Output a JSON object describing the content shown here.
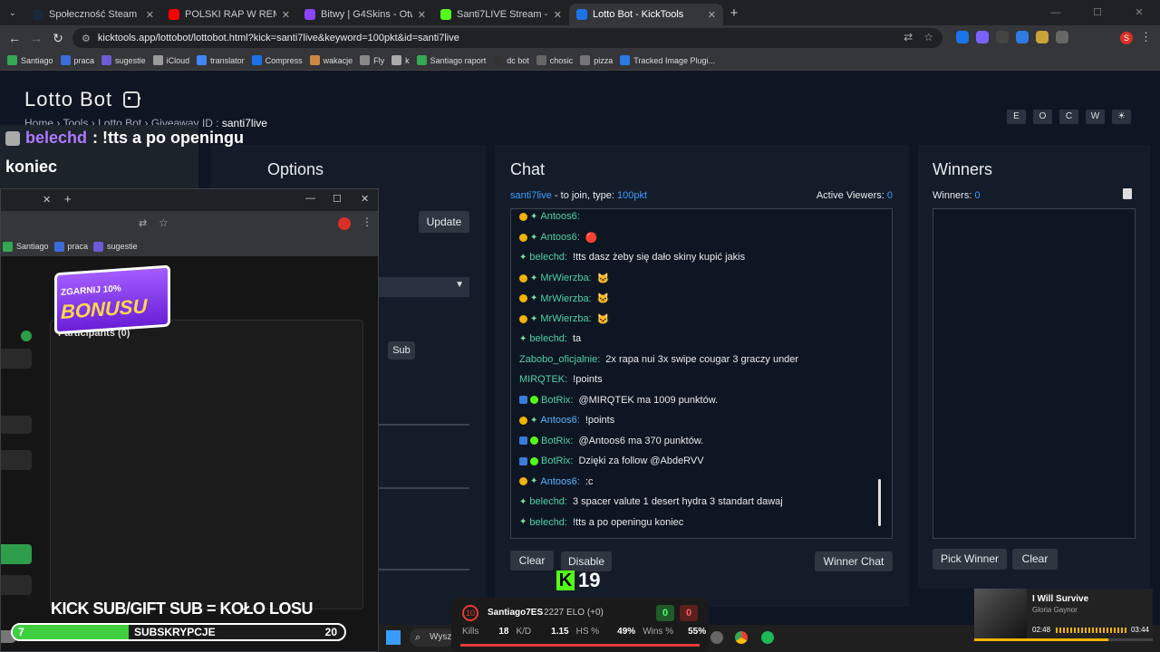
{
  "browser": {
    "tabs": [
      {
        "title": "Społeczność Steam :: Santiago",
        "color": "#1b2838",
        "active": false
      },
      {
        "title": "POLSKI RAP W REMIX",
        "color": "#ff0000",
        "active": false
      },
      {
        "title": "Bitwy | G4Skins - Otwieraj skrzy",
        "color": "#8e44ff",
        "active": false
      },
      {
        "title": "Santi7LIVE Stream - Watch Live",
        "color": "#53fc18",
        "active": false
      },
      {
        "title": "Lotto Bot - KickTools",
        "color": "#1a73e8",
        "active": true
      }
    ],
    "url": "kicktools.app/lottobot/lottobot.html?kick=santi7live&keyword=100pkt&id=santi7live",
    "bookmarks": [
      "Santiago",
      "praca",
      "sugestie",
      "iCloud",
      "translator",
      "Compress",
      "wakacje",
      "Fly",
      "k",
      "Santiago raport",
      "dc bot",
      "chosic",
      "pizza",
      "Tracked Image Plugi..."
    ]
  },
  "page": {
    "title": "Lotto Bot",
    "breadcrumb_prefix": "Home › Tools › Lotto Bot › Giveaway ID :",
    "giveaway_id": "santi7live",
    "top_buttons": [
      "E",
      "O",
      "C",
      "W",
      "☀"
    ]
  },
  "options": {
    "title": "Options",
    "update_label": "Update",
    "sub_label": "Sub"
  },
  "chat": {
    "title": "Chat",
    "user": "santi7live",
    "join_text": "- to join, type:",
    "keyword": "100pkt",
    "active_viewers_label": "Active Viewers:",
    "active_viewers": "0",
    "messages": [
      {
        "nick": "Antoos6:",
        "text": "",
        "badges": "gold",
        "blue": false
      },
      {
        "nick": "Antoos6:",
        "text": "🔴",
        "badges": "gold",
        "blue": false
      },
      {
        "nick": "belechd:",
        "text": "!tts dasz żeby się dało skiny kupić jakis",
        "badges": "star",
        "blue": false
      },
      {
        "nick": "MrWierzba:",
        "text": "🐱",
        "badges": "gold",
        "blue": false
      },
      {
        "nick": "MrWierzba:",
        "text": "🐱",
        "badges": "gold",
        "blue": false
      },
      {
        "nick": "MrWierzba:",
        "text": "🐱",
        "badges": "gold",
        "blue": false
      },
      {
        "nick": "belechd:",
        "text": "ta",
        "badges": "star",
        "blue": false
      },
      {
        "nick": "Zabobo_oficjalnie:",
        "text": "2x rapa nui 3x swipe cougar 3 graczy under",
        "badges": "",
        "blue": false
      },
      {
        "nick": "MIRQTEK:",
        "text": "!points",
        "badges": "",
        "blue": false
      },
      {
        "nick": "BotRix:",
        "text": "@MIRQTEK ma 1009 punktów.",
        "badges": "bot",
        "blue": false
      },
      {
        "nick": "Antoos6:",
        "text": "!points",
        "badges": "gold",
        "blue": true
      },
      {
        "nick": "BotRix:",
        "text": "@Antoos6 ma 370 punktów.",
        "badges": "bot",
        "blue": false
      },
      {
        "nick": "BotRix:",
        "text": "Dzięki za follow @AbdeRVV",
        "badges": "bot",
        "blue": false
      },
      {
        "nick": "Antoos6:",
        "text": ":c",
        "badges": "gold",
        "blue": true
      },
      {
        "nick": "belechd:",
        "text": "3 spacer valute 1 desert hydra 3 standart dawaj",
        "badges": "star",
        "blue": false
      },
      {
        "nick": "belechd:",
        "text": "!tts a po openingu koniec",
        "badges": "star",
        "blue": false
      }
    ],
    "clear_label": "Clear",
    "disable_label": "Disable",
    "winner_chat_label": "Winner Chat"
  },
  "winners": {
    "title": "Winners",
    "count_label": "Winners:",
    "count": "0",
    "pick_label": "Pick Winner",
    "clear_label": "Clear"
  },
  "overlay": {
    "stream_nick": "belechd",
    "stream_msg_1": ": !tts a po openingu",
    "stream_msg_2": "koniec",
    "participants": "Participants (0)",
    "bonus_top": "ZGARNIJ 10%",
    "bonus_main": "BONUSU",
    "sub_banner": "KICK SUB/GIFT SUB = KOŁO LOSU",
    "sub_current": "7",
    "sub_label": "SUBSKRYPCJE",
    "sub_goal": "20",
    "sub_progress": 0.35,
    "kick_viewers": "19",
    "faceit_level": "10",
    "faceit_name": "Santiago7ES",
    "faceit_elo": "2227 ELO (+0)",
    "score_left": "0",
    "score_right": "0",
    "kills_label": "Kills",
    "kills": "18",
    "kd_label": "K/D",
    "kd": "1.15",
    "hs_label": "HS %",
    "hs": "49%",
    "wins_label": "Wins %",
    "wins": "55%",
    "search_label": "Wysz",
    "song": "I Will Survive",
    "artist": "Gloria Gaynor",
    "time_elapsed": "02:48",
    "time_total": "03:44",
    "song_progress": 0.75
  }
}
